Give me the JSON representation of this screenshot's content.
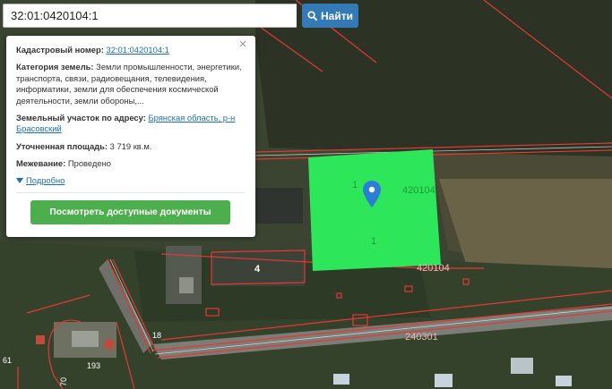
{
  "search": {
    "value": "32:01:0420104:1",
    "button_label": "Найти"
  },
  "popup": {
    "cadastral_label": "Кадастровый номер:",
    "cadastral_value": "32:01:0420104:1",
    "category_label": "Категория земель:",
    "category_value": "Земли промышленности, энергетики, транспорта, связи, радиовещания, телевидения, информатики, земли для обеспечения космической деятельности, земли обороны,...",
    "address_label": "Земельный участок по адресу:",
    "address_value": "Брянская область, р-н Брасовский",
    "area_label": "Уточненная площадь:",
    "area_value": "3 719 кв.м.",
    "survey_label": "Межевание:",
    "survey_value": "Проведено",
    "details_label": "Подробно",
    "docs_button_label": "Посмотреть доступные документы",
    "close_symbol": "×"
  },
  "map": {
    "parcel_number_1": "1",
    "parcel_number_2": "1",
    "block_label_top": "420104",
    "block_label_bottom": "420104",
    "building_number": "4",
    "road_block_label": "240301",
    "label_18": "18",
    "label_193": "193",
    "label_61": "61",
    "label_70": "70",
    "parcel_color": "#2ee65a",
    "marker_color": "#2a7fd4",
    "cadastral_line_color": "#e23838"
  }
}
